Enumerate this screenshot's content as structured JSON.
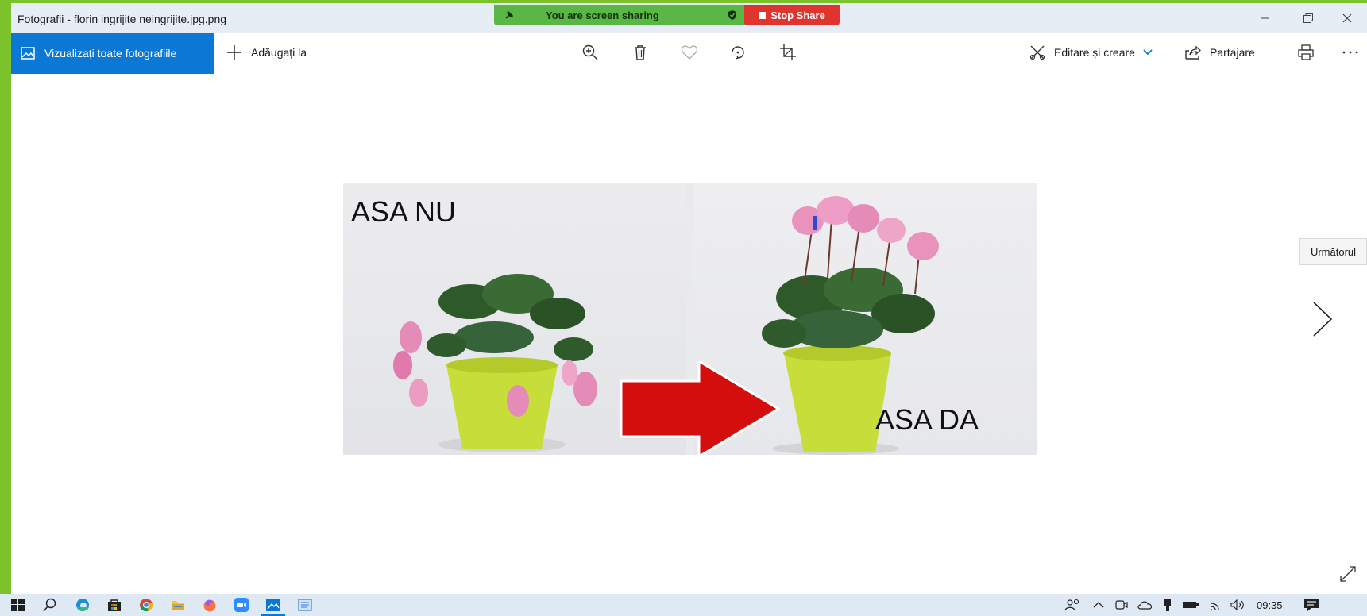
{
  "window": {
    "title": "Fotografii - florin ingrijite neingrijite.jpg.png",
    "minimize_icon": "minimize-icon",
    "restore_icon": "restore-icon",
    "close_icon": "close-icon"
  },
  "screen_share": {
    "status_text": "You are screen sharing",
    "stop_label": "Stop Share",
    "colors": {
      "status_bg": "#5bb745",
      "stop_bg": "#e0342e"
    }
  },
  "toolbar": {
    "view_all_label": "Vizualizați toate fotografiile",
    "add_to_label": "Adăugați la",
    "center_icons": [
      "zoom-in-icon",
      "delete-icon",
      "heart-icon",
      "rotate-icon",
      "crop-icon"
    ],
    "edit_create_label": "Editare și creare",
    "share_label": "Partajare",
    "print_icon": "print-icon",
    "more_icon": "more-icon",
    "accent_color": "#0a78d4"
  },
  "photo": {
    "left_label": "ASA NU",
    "right_label": "ASA DA"
  },
  "navigation": {
    "next_tooltip": "Următorul",
    "next_icon": "chevron-right-icon",
    "expand_icon": "expand-icon"
  },
  "taskbar": {
    "apps": [
      "windows-start-icon",
      "search-icon",
      "edge-icon",
      "store-icon",
      "chrome-icon",
      "file-explorer-icon",
      "firefox-icon",
      "zoom-icon",
      "photos-icon",
      "notepad-icon"
    ],
    "clock": "09:35"
  }
}
